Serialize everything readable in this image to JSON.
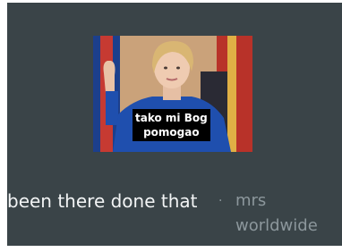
{
  "post": {
    "image_caption_line1": "tako mi Bog",
    "image_caption_line2": "pomogao",
    "title": "been there done that",
    "separator": "·",
    "author": "mrs worldwide"
  },
  "colors": {
    "card_background": "#3a4448",
    "title_text": "#f2f4f5",
    "author_text": "#8c979c",
    "caption_background": "#000000"
  }
}
